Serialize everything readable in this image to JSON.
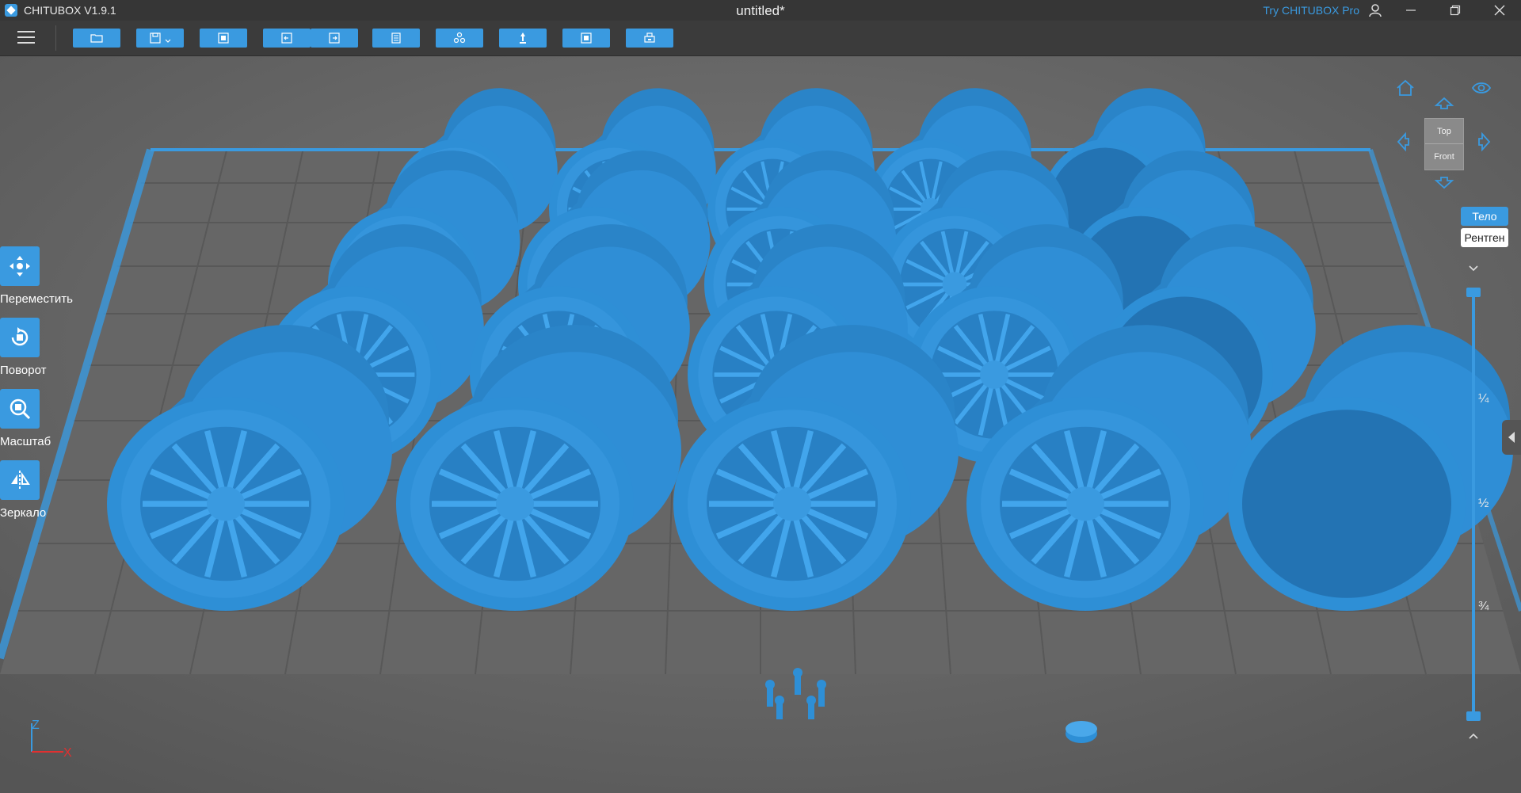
{
  "titlebar": {
    "app_name": "CHITUBOX V1.9.1",
    "document_title": "untitled*",
    "try_pro": "Try CHITUBOX Pro",
    "icons": [
      "user-icon",
      "minimize-icon",
      "maximize-icon",
      "close-icon"
    ]
  },
  "toolbar": {
    "buttons": [
      "open-file-icon",
      "save-icon",
      "fit-icon",
      "undo-icon",
      "redo-icon",
      "slice-settings-icon",
      "auto-layout-icon",
      "supports-icon",
      "hollow-icon",
      "print-icon"
    ]
  },
  "tools": [
    {
      "label": "Переместить",
      "icon": "move-icon"
    },
    {
      "label": "Поворот",
      "icon": "rotate-icon"
    },
    {
      "label": "Масштаб",
      "icon": "scale-icon"
    },
    {
      "label": "Зеркало",
      "icon": "mirror-icon"
    }
  ],
  "view_cube": {
    "top": "Top",
    "front": "Front"
  },
  "render_mode": {
    "body": "Тело",
    "xray": "Рентген"
  },
  "layer_slider": {
    "fractions": [
      "¼",
      "½",
      "¾"
    ]
  },
  "axis": {
    "z": "Z",
    "x": "X"
  },
  "colors": {
    "accent": "#3a9ae0",
    "model": "#2e8fd6",
    "background": "#646464",
    "titlebar": "#363636",
    "toolbar": "#3b3b3b"
  }
}
